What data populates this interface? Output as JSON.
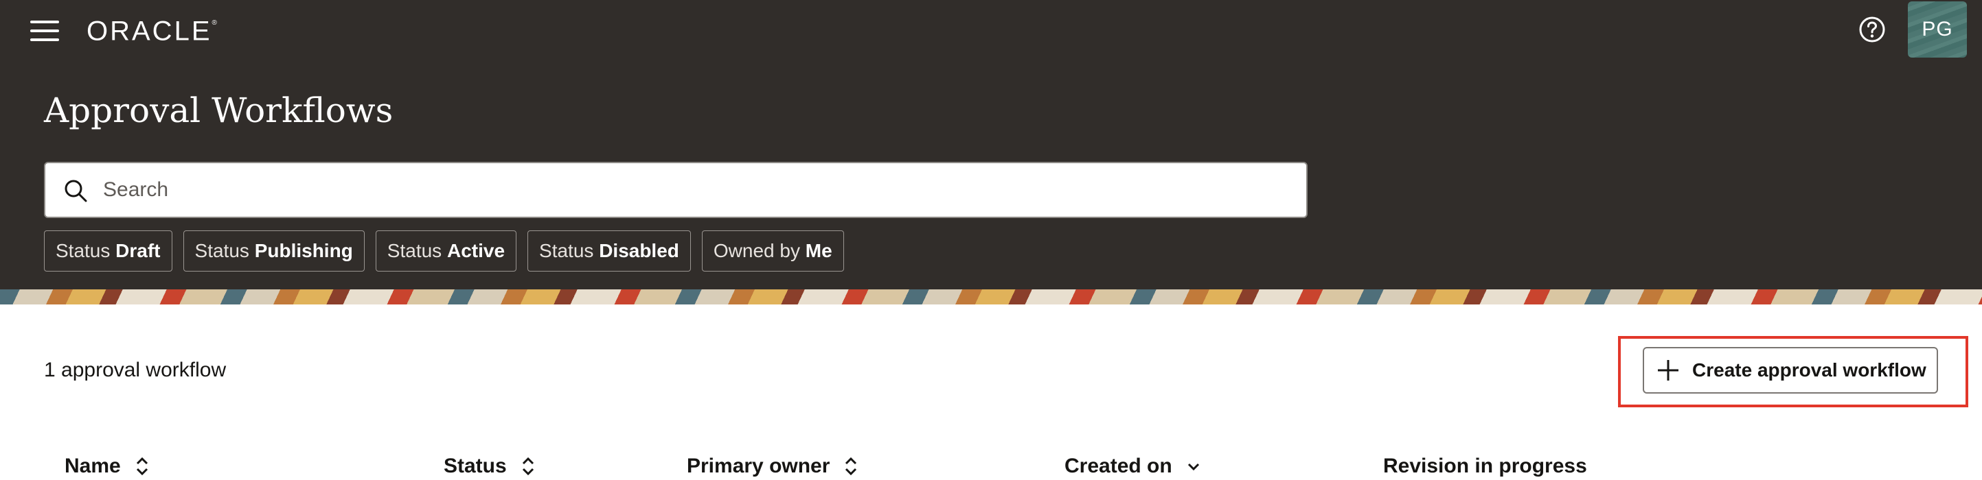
{
  "header": {
    "logo_text": "ORACLE",
    "logo_mark": "®",
    "menu_icon": "hamburger-menu-icon",
    "help_icon": "help-circle-icon",
    "avatar_initials": "PG",
    "background_color": "#312d2a"
  },
  "page": {
    "title": "Approval Workflows"
  },
  "search": {
    "placeholder": "Search",
    "value": "",
    "icon": "search-icon"
  },
  "filters": [
    {
      "key": "Status",
      "value": "Draft"
    },
    {
      "key": "Status",
      "value": "Publishing"
    },
    {
      "key": "Status",
      "value": "Active"
    },
    {
      "key": "Status",
      "value": "Disabled"
    },
    {
      "key": "Owned by",
      "value": "Me"
    }
  ],
  "results": {
    "count_text": "1 approval workflow"
  },
  "actions": {
    "create_label": "Create approval workflow",
    "create_icon": "plus-icon",
    "highlight_color": "#e2372a"
  },
  "table": {
    "columns": [
      {
        "label": "Name",
        "sort": "sortable"
      },
      {
        "label": "Status",
        "sort": "sortable"
      },
      {
        "label": "Primary owner",
        "sort": "sortable"
      },
      {
        "label": "Created on",
        "sort": "descending"
      },
      {
        "label": "Revision in progress",
        "sort": "none"
      }
    ]
  }
}
